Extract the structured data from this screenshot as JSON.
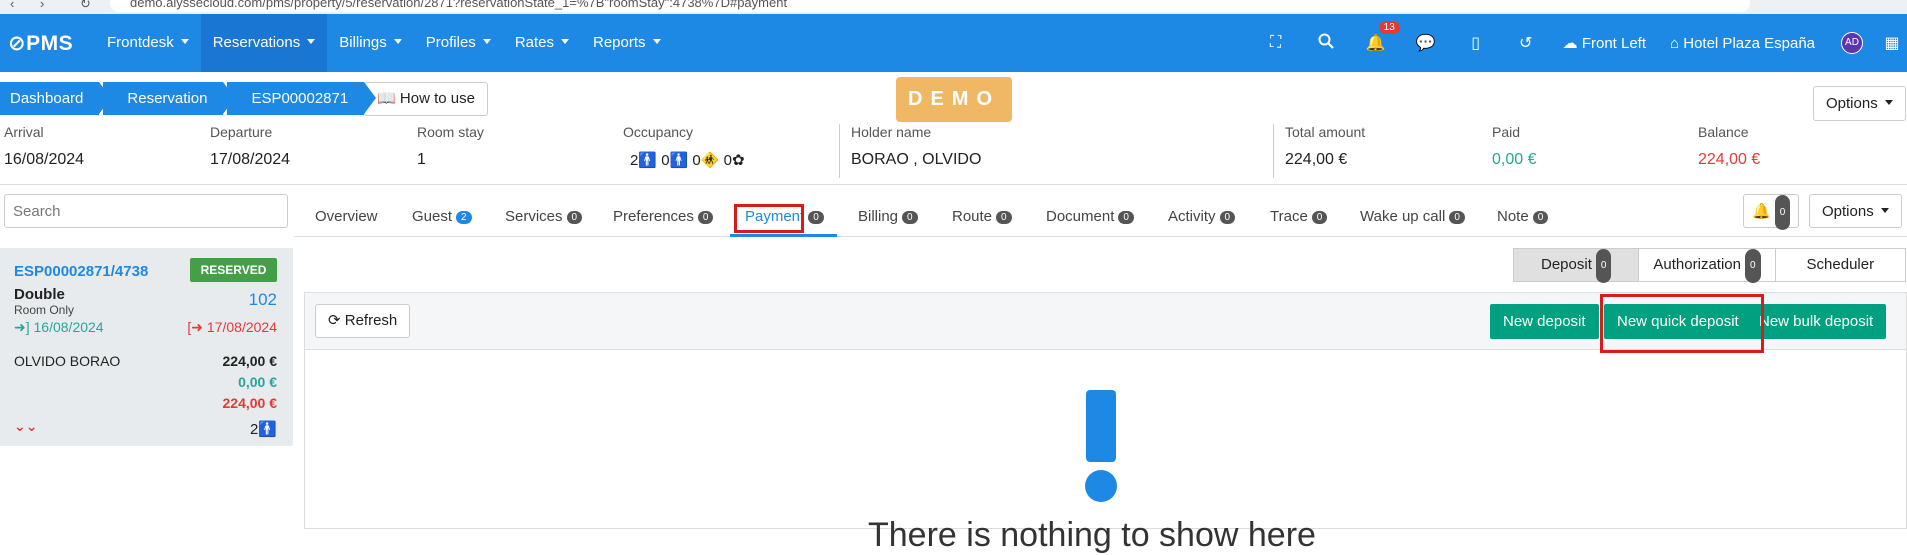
{
  "browser": {
    "url": "demo.alyssecloud.com/pms/property/5/reservation/2871?reservationState_1=%7B\"roomStay\":4738%7D#payment"
  },
  "nav": {
    "logo": "PMS",
    "menu": [
      {
        "label": "Frontdesk"
      },
      {
        "label": "Reservations"
      },
      {
        "label": "Billings"
      },
      {
        "label": "Profiles"
      },
      {
        "label": "Rates"
      },
      {
        "label": "Reports"
      }
    ],
    "notif_count": "13",
    "front": "Front Left",
    "hotel": "Hotel Plaza España",
    "avatar": "AD"
  },
  "breadcrumb": [
    "Dashboard",
    "Reservation",
    "ESP00002871"
  ],
  "howto_label": "How to use",
  "demo_label": "DEMO",
  "options_label": "Options",
  "info": {
    "arrival_label": "Arrival",
    "arrival": "16/08/2024",
    "departure_label": "Departure",
    "departure": "17/08/2024",
    "roomstay_label": "Room stay",
    "roomstay": "1",
    "occupancy_label": "Occupancy",
    "occ": [
      "2",
      "0",
      "0",
      "0"
    ],
    "holder_label": "Holder name",
    "holder": "BORAO , OLVIDO",
    "total_label": "Total amount",
    "total": "224,00 €",
    "paid_label": "Paid",
    "paid": "0,00 €",
    "balance_label": "Balance",
    "balance": "224,00 €"
  },
  "sidebar": {
    "search_placeholder": "Search",
    "card": {
      "id": "ESP00002871/4738",
      "status": "RESERVED",
      "room_type": "Double",
      "board": "Room Only",
      "room_no": "102",
      "checkin": "16/08/2024",
      "checkout": "17/08/2024",
      "guest": "OLVIDO BORAO",
      "amount": "224,00 €",
      "paid": "0,00 €",
      "balance": "224,00 €",
      "pax": "2"
    }
  },
  "tabs": [
    {
      "label": "Overview",
      "count": ""
    },
    {
      "label": "Guest",
      "count": "2"
    },
    {
      "label": "Services",
      "count": "0"
    },
    {
      "label": "Preferences",
      "count": "0"
    },
    {
      "label": "Payment",
      "count": "0"
    },
    {
      "label": "Billing",
      "count": "0"
    },
    {
      "label": "Route",
      "count": "0"
    },
    {
      "label": "Document",
      "count": "0"
    },
    {
      "label": "Activity",
      "count": "0"
    },
    {
      "label": "Trace",
      "count": "0"
    },
    {
      "label": "Wake up call",
      "count": "0"
    },
    {
      "label": "Note",
      "count": "0"
    }
  ],
  "alerts_count": "0",
  "subtabs": [
    {
      "label": "Deposit",
      "count": "0"
    },
    {
      "label": "Authorization",
      "count": "0"
    },
    {
      "label": "Scheduler",
      "count": ""
    }
  ],
  "toolbar": {
    "refresh": "Refresh",
    "new_deposit": "New deposit",
    "new_quick_deposit": "New quick deposit",
    "new_bulk_deposit": "New bulk deposit"
  },
  "empty_text": "There is nothing to show here",
  "colors": {
    "primary": "#1e88e5",
    "green": "#00a080",
    "paid": "#26a69a",
    "balance": "#e53935",
    "highlight": "#d81b1b"
  }
}
